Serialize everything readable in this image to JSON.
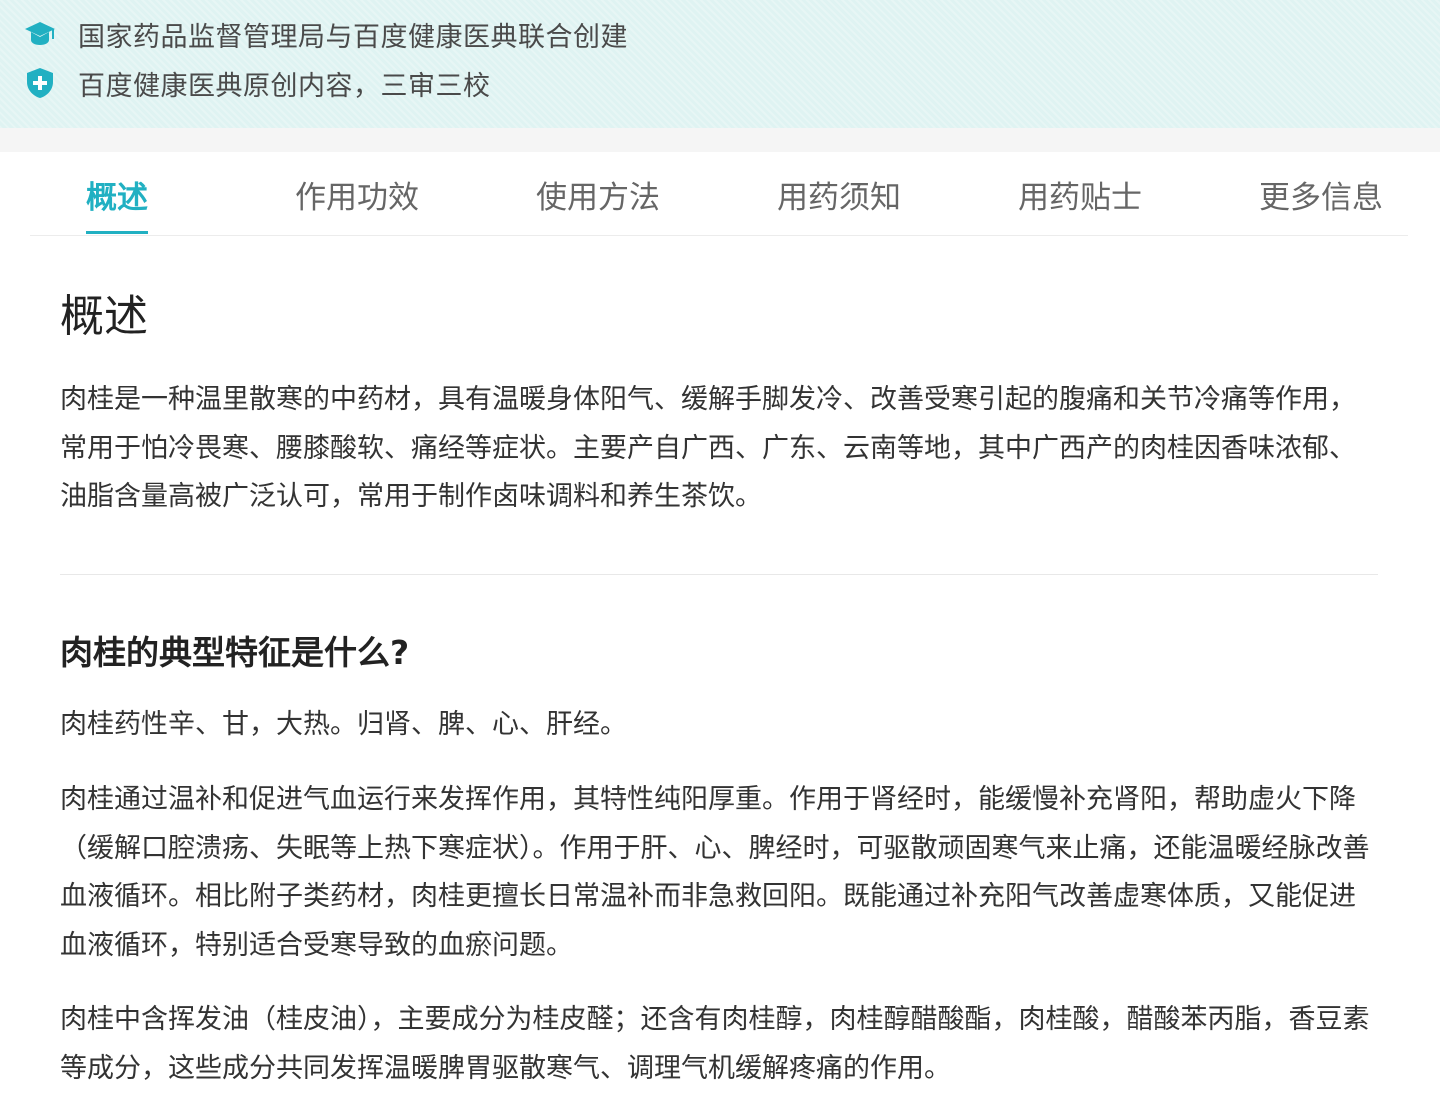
{
  "banner": {
    "line1": "国家药品监督管理局与百度健康医典联合创建",
    "line1_icon": "graduation-cap-icon",
    "line2": "百度健康医典原创内容，三审三校",
    "line2_icon": "shield-plus-icon",
    "accent_color": "#21b0c2"
  },
  "tabs": [
    {
      "label": "概述",
      "active": true
    },
    {
      "label": "作用功效",
      "active": false
    },
    {
      "label": "使用方法",
      "active": false
    },
    {
      "label": "用药须知",
      "active": false
    },
    {
      "label": "用药贴士",
      "active": false
    },
    {
      "label": "更多信息",
      "active": false
    }
  ],
  "overview": {
    "title": "概述",
    "paragraph": "肉桂是一种温里散寒的中药材，具有温暖身体阳气、缓解手脚发冷、改善受寒引起的腹痛和关节冷痛等作用，常用于怕冷畏寒、腰膝酸软、痛经等症状。主要产自广西、广东、云南等地，其中广西产的肉桂因香味浓郁、油脂含量高被广泛认可，常用于制作卤味调料和养生茶饮。"
  },
  "features": {
    "title": "肉桂的典型特征是什么?",
    "paragraphs": [
      "肉桂药性辛、甘，大热。归肾、脾、心、肝经。",
      "肉桂通过温补和促进气血运行来发挥作用，其特性纯阳厚重。作用于肾经时，能缓慢补充肾阳，帮助虚火下降（缓解口腔溃疡、失眠等上热下寒症状）。作用于肝、心、脾经时，可驱散顽固寒气来止痛，还能温暖经脉改善血液循环。相比附子类药材，肉桂更擅长日常温补而非急救回阳。既能通过补充阳气改善虚寒体质，又能促进血液循环，特别适合受寒导致的血瘀问题。",
      "肉桂中含挥发油（桂皮油），主要成分为桂皮醛；还含有肉桂醇，肉桂醇醋酸酯，肉桂酸，醋酸苯丙脂，香豆素等成分，这些成分共同发挥温暖脾胃驱散寒气、调理气机缓解疼痛的作用。"
    ]
  }
}
